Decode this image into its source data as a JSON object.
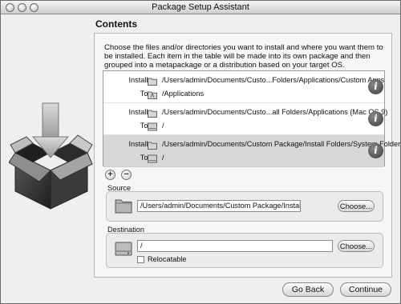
{
  "window": {
    "title": "Package Setup Assistant"
  },
  "content": {
    "heading": "Contents",
    "description": "Choose the files and/or directories you want to install and where you want them to be installed. Each item in the table will be made into its own package and then grouped into a metapackage or a distribution based on your target OS."
  },
  "table": {
    "install_label": "Install:",
    "to_label": "To:",
    "rows": [
      {
        "install": "/Users/admin/Documents/Custo...Folders/Applications/Custom Apps",
        "to": "/Applications"
      },
      {
        "install": "/Users/admin/Documents/Custo...all Folders/Applications (Mac OS 9)",
        "to": "/"
      },
      {
        "install": "/Users/admin/Documents/Custom Package/Install Folders/System Folder",
        "to": "/"
      }
    ]
  },
  "controls": {
    "add": "+",
    "remove": "−"
  },
  "source": {
    "title": "Source",
    "path": "/Users/admin/Documents/Custom Package/Install Folders/System",
    "choose": "Choose..."
  },
  "destination": {
    "title": "Destination",
    "path": "/",
    "choose": "Choose...",
    "relocatable": "Relocatable",
    "relocatable_checked": false
  },
  "nav": {
    "back": "Go Back",
    "continue": "Continue"
  }
}
